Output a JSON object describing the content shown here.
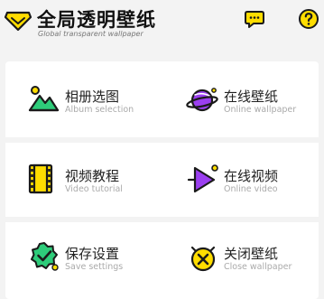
{
  "header": {
    "title": "全局透明壁纸",
    "subtitle": "Global transparent wallpaper",
    "logo_icon": "diamond-logo-icon",
    "message_icon": "chat-bubble-icon",
    "help_icon": "question-mark-icon"
  },
  "colors": {
    "accent_yellow": "#ffdd00",
    "icon_purple": "#9b3ff0",
    "icon_green": "#2ecc7a",
    "outline": "#1a1a1a",
    "background": "#f3f3f3"
  },
  "menu": [
    {
      "label": "相册选图",
      "sub": "Album selection",
      "icon": "mountain-photo-icon"
    },
    {
      "label": "在线壁纸",
      "sub": "Online wallpaper",
      "icon": "planet-icon"
    },
    {
      "label": "视频教程",
      "sub": "Video tutorial",
      "icon": "film-strip-icon"
    },
    {
      "label": "在线视频",
      "sub": "Online video",
      "icon": "play-icon"
    },
    {
      "label": "保存设置",
      "sub": "Save settings",
      "icon": "badge-check-icon"
    },
    {
      "label": "关闭壁纸",
      "sub": "Close wallpaper",
      "icon": "close-circle-icon"
    }
  ]
}
